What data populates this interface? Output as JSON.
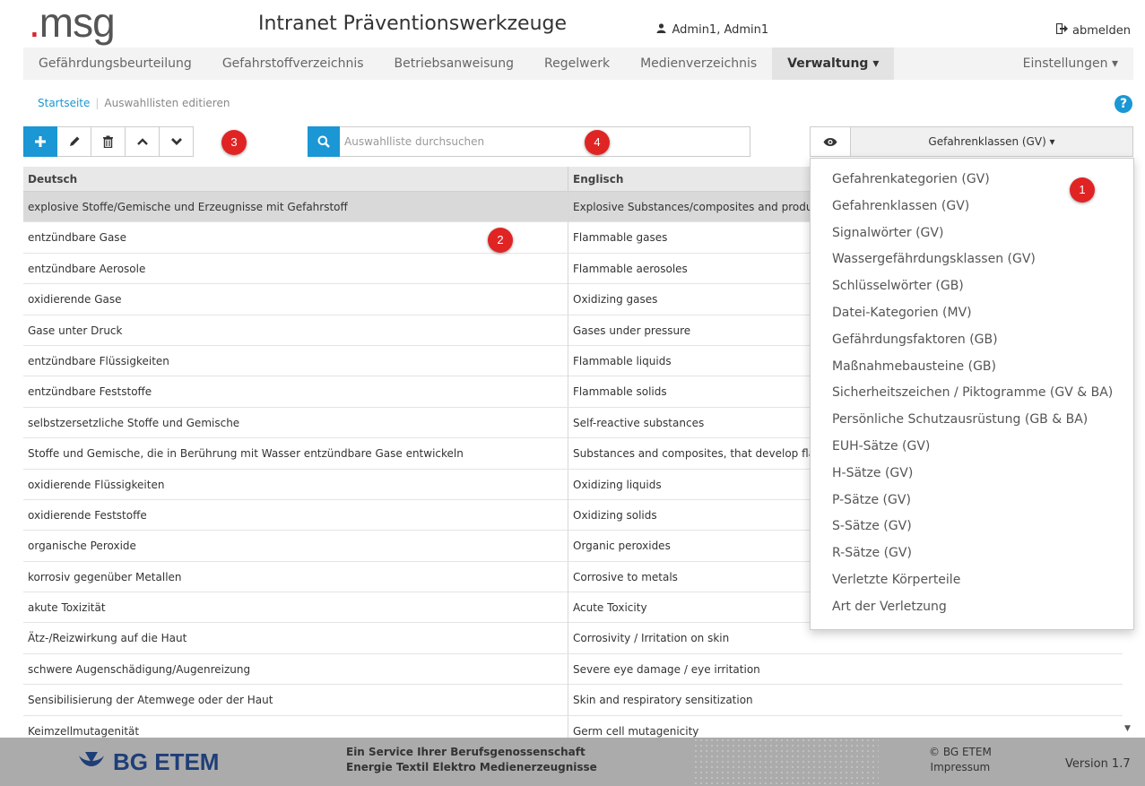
{
  "header": {
    "logo_dot": ".",
    "logo_text": "msg",
    "title": "Intranet Präventionswerkzeuge",
    "user": "Admin1, Admin1",
    "logout": "abmelden"
  },
  "nav": {
    "items": [
      {
        "label": "Gefährdungsbeurteilung"
      },
      {
        "label": "Gefahrstoffverzeichnis"
      },
      {
        "label": "Betriebsanweisung"
      },
      {
        "label": "Regelwerk"
      },
      {
        "label": "Medienverzeichnis"
      },
      {
        "label": "Verwaltung ▾"
      },
      {
        "label": "Einstellungen ▾"
      }
    ],
    "active": "Verwaltung"
  },
  "breadcrumb": {
    "home": "Startseite",
    "current": "Auswahllisten editieren"
  },
  "help_label": "?",
  "toolbar": {
    "icons": [
      "plus-icon",
      "pencil-icon",
      "trash-icon",
      "chevron-up-icon",
      "chevron-down-icon"
    ]
  },
  "search": {
    "placeholder": "Auswahlliste durchsuchen",
    "value": ""
  },
  "list_select": {
    "selected": "Gefahrenklassen (GV) ▾",
    "options": [
      "Gefahrenkategorien (GV)",
      "Gefahrenklassen (GV)",
      "Signalwörter (GV)",
      "Wassergefährdungsklassen (GV)",
      "Schlüsselwörter (GB)",
      "Datei-Kategorien (MV)",
      "Gefährdungsfaktoren (GB)",
      "Maßnahmebausteine (GB)",
      "Sicherheitszeichen / Piktogramme (GV & BA)",
      "Persönliche Schutzausrüstung (GB & BA)",
      "EUH-Sätze (GV)",
      "H-Sätze (GV)",
      "P-Sätze (GV)",
      "S-Sätze (GV)",
      "R-Sätze (GV)",
      "Verletzte Körperteile",
      "Art der Verletzung"
    ]
  },
  "table": {
    "columns": [
      "Deutsch",
      "Englisch"
    ],
    "rows": [
      [
        "explosive Stoffe/Gemische und Erzeugnisse mit Gefahrstoff",
        "Explosive Substances/composites and products with explosives"
      ],
      [
        "entzündbare Gase",
        "Flammable gases"
      ],
      [
        "entzündbare Aerosole",
        "Flammable aerosoles"
      ],
      [
        "oxidierende Gase",
        "Oxidizing gases"
      ],
      [
        "Gase unter Druck",
        "Gases under pressure"
      ],
      [
        "entzündbare Flüssigkeiten",
        "Flammable liquids"
      ],
      [
        "entzündbare Feststoffe",
        "Flammable solids"
      ],
      [
        "selbstzersetzliche Stoffe und Gemische",
        "Self-reactive substances"
      ],
      [
        "Stoffe und Gemische, die in Berührung mit Wasser entzündbare Gase entwickeln",
        "Substances and composites, that develop flammable gases in contact with water"
      ],
      [
        "oxidierende Flüssigkeiten",
        "Oxidizing liquids"
      ],
      [
        "oxidierende Feststoffe",
        "Oxidizing solids"
      ],
      [
        "organische Peroxide",
        "Organic peroxides"
      ],
      [
        "korrosiv gegenüber Metallen",
        "Corrosive to metals"
      ],
      [
        "akute Toxizität",
        "Acute Toxicity"
      ],
      [
        "Ätz-/Reizwirkung auf die Haut",
        "Corrosivity / Irritation on skin"
      ],
      [
        "schwere Augenschädigung/Augenreizung",
        "Severe eye damage / eye irritation"
      ],
      [
        "Sensibilisierung der Atemwege oder der Haut",
        "Skin and respiratory sensitization"
      ],
      [
        "Keimzellmutagenität",
        "Germ cell mutagenicity"
      ]
    ],
    "selected_row": 0
  },
  "callouts": [
    "1",
    "2",
    "3",
    "4"
  ],
  "footer": {
    "logo_text": "BG ETEM",
    "service_line1": "Ein Service Ihrer Berufsgenossenschaft",
    "service_line2": "Energie Textil Elektro Medienerzeugnisse",
    "copyright": "© BG ETEM",
    "impressum": "Impressum",
    "version": "Version 1.7"
  },
  "colors": {
    "accent": "#1a97d4",
    "callout": "#e02424",
    "brand_red": "#d9262b",
    "footer_bg": "#ababab"
  }
}
